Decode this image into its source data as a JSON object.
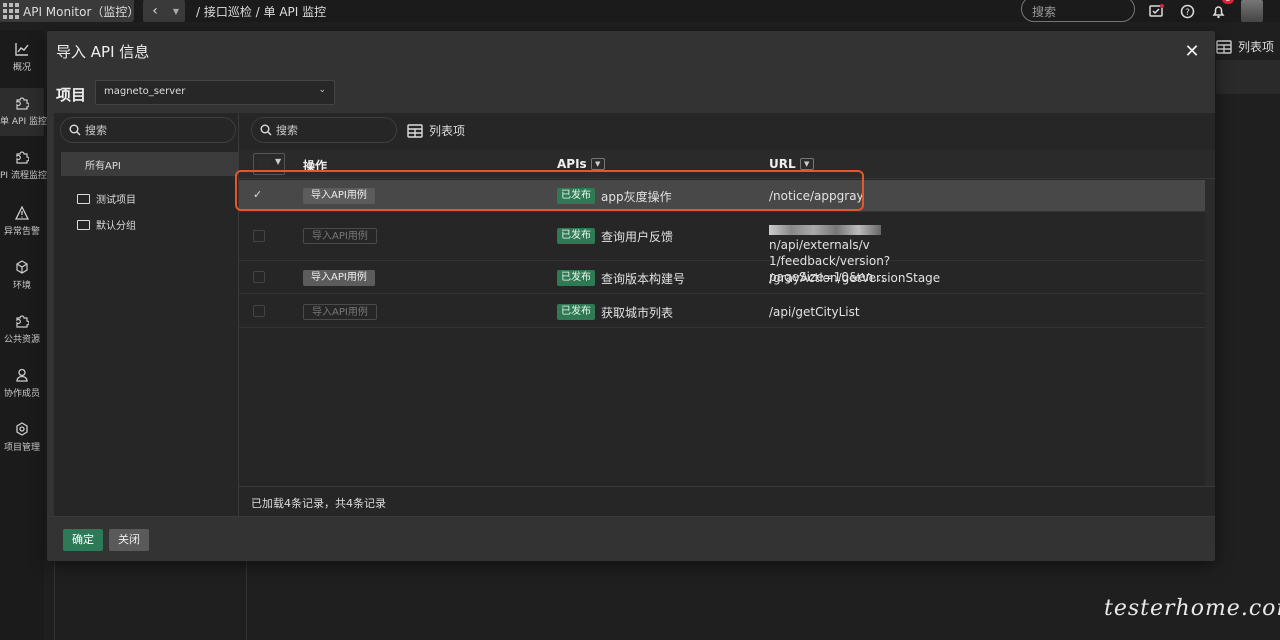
{
  "app": {
    "title": "API Monitor（监控）",
    "grid_icon": "apps-grid-icon"
  },
  "breadcrumb": "/ 接口巡检 / 单 API 监控",
  "topbar": {
    "search_placeholder": "搜索",
    "notification_count": "2"
  },
  "leftnav": {
    "items": [
      {
        "label": "概况",
        "icon": "chart-line-icon"
      },
      {
        "label": "单 API 监控",
        "icon": "puzzle-icon"
      },
      {
        "label": "PI 流程监控",
        "icon": "puzzle-icon"
      },
      {
        "label": "异常告警",
        "icon": "warning-icon"
      },
      {
        "label": "环境",
        "icon": "cube-icon"
      },
      {
        "label": "公共资源",
        "icon": "puzzle-icon"
      },
      {
        "label": "协作成员",
        "icon": "user-icon"
      },
      {
        "label": "项目管理",
        "icon": "gear-icon"
      }
    ]
  },
  "background": {
    "column_button_label": "列表项"
  },
  "modal": {
    "title": "导入 API 信息",
    "project_label": "项目",
    "project_value": "magneto_server",
    "tree": {
      "search_placeholder": "搜索",
      "all_label": "所有API",
      "folders": [
        "测试项目",
        "默认分组"
      ]
    },
    "table": {
      "search_placeholder": "搜索",
      "columns_button": "列表项",
      "headers": {
        "op": "操作",
        "apis": "APIs",
        "url": "URL"
      },
      "rows": [
        {
          "checked": true,
          "op": "导入API用例",
          "op_enabled": true,
          "status": "已发布",
          "name": "app灰度操作",
          "url": "/notice/appgray"
        },
        {
          "checked": false,
          "op": "导入API用例",
          "op_enabled": false,
          "status": "已发布",
          "name": "查询用户反馈",
          "url_line1": "n/api/externals/v",
          "url_line2": "1/feedback/version?pageSize=10&en…"
        },
        {
          "checked": false,
          "op": "导入API用例",
          "op_enabled": true,
          "status": "已发布",
          "name": "查询版本构建号",
          "url": "/grayAction/getVersionStage"
        },
        {
          "checked": false,
          "op": "导入API用例",
          "op_enabled": false,
          "status": "已发布",
          "name": "获取城市列表",
          "url": "/api/getCityList"
        }
      ],
      "footer": "已加载4条记录，共4条记录"
    },
    "ok_label": "确定",
    "close_label": "关闭"
  },
  "watermark": "testerhome.com",
  "colors": {
    "accent_green": "#2e7a58",
    "highlight_border": "#e2572b",
    "modal_bg": "#333333"
  }
}
